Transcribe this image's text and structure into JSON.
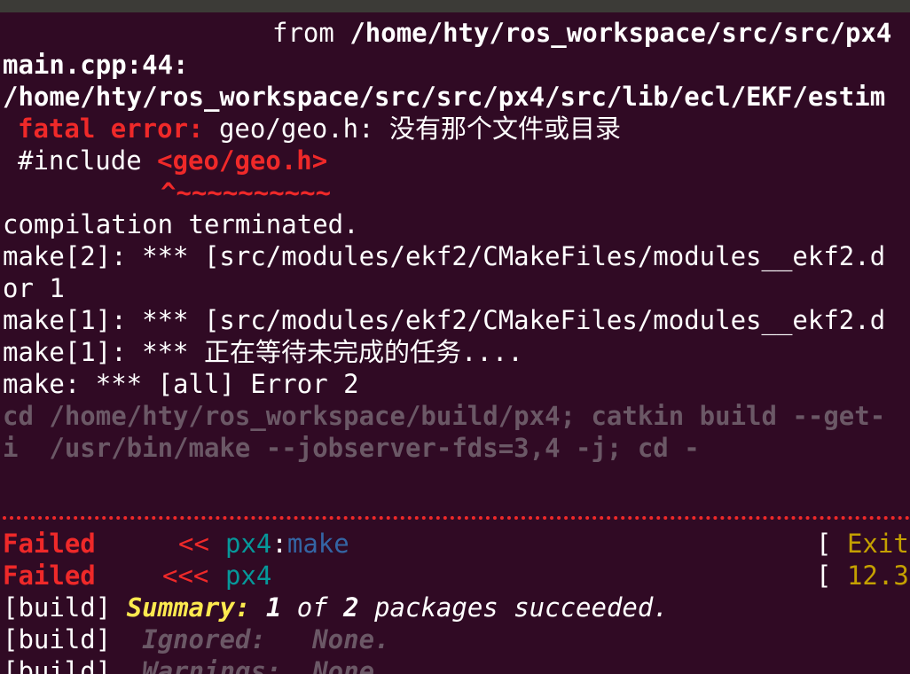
{
  "terminal": {
    "line_from_prefix": "from ",
    "line_from_path": "/home/hty/ros_workspace/src/src/px4",
    "line_main": "main.cpp:44:",
    "line_path": "/home/hty/ros_workspace/src/src/px4/src/lib/ecl/EKF/estim",
    "fatal_label": "fatal error:",
    "fatal_msg": " geo/geo.h: 没有那个文件或目录",
    "include_prefix": "#include ",
    "include_target": "<geo/geo.h>",
    "caret": "^~~~~~~~~~~",
    "compilation": "compilation terminated.",
    "make2": "make[2]: *** [src/modules/ekf2/CMakeFiles/modules__ekf2.d",
    "or1": "or 1",
    "make1a": "make[1]: *** [src/modules/ekf2/CMakeFiles/modules__ekf2.d",
    "make1b": "make[1]: *** 正在等待未完成的任务....",
    "make_all": "make: *** [all] Error 2",
    "cd_line": "cd /home/hty/ros_workspace/build/px4; catkin build --get-",
    "i_line": "i  /usr/bin/make --jobserver-fds=3,4 -j; cd -",
    "failed1_label": "Failed",
    "failed1_arrows": "<<",
    "failed1_pkg": "px4",
    "failed1_colon": ":",
    "failed1_target": "make",
    "failed1_bracket": "[",
    "failed1_status": "Exit",
    "failed2_label": "Failed",
    "failed2_arrows": "<<<",
    "failed2_pkg": "px4",
    "failed2_bracket": "[",
    "failed2_time": "12.3",
    "summary_prefix": "[build] ",
    "summary_label": "Summary:",
    "summary_n1": "1",
    "summary_of": " of ",
    "summary_n2": "2",
    "summary_rest": " packages succeeded.",
    "ignored_prefix": "[build]  ",
    "ignored_text": "Ignored:   None.",
    "warnings_prefix": "[build]  ",
    "warnings_text": "Warnings:  None."
  }
}
